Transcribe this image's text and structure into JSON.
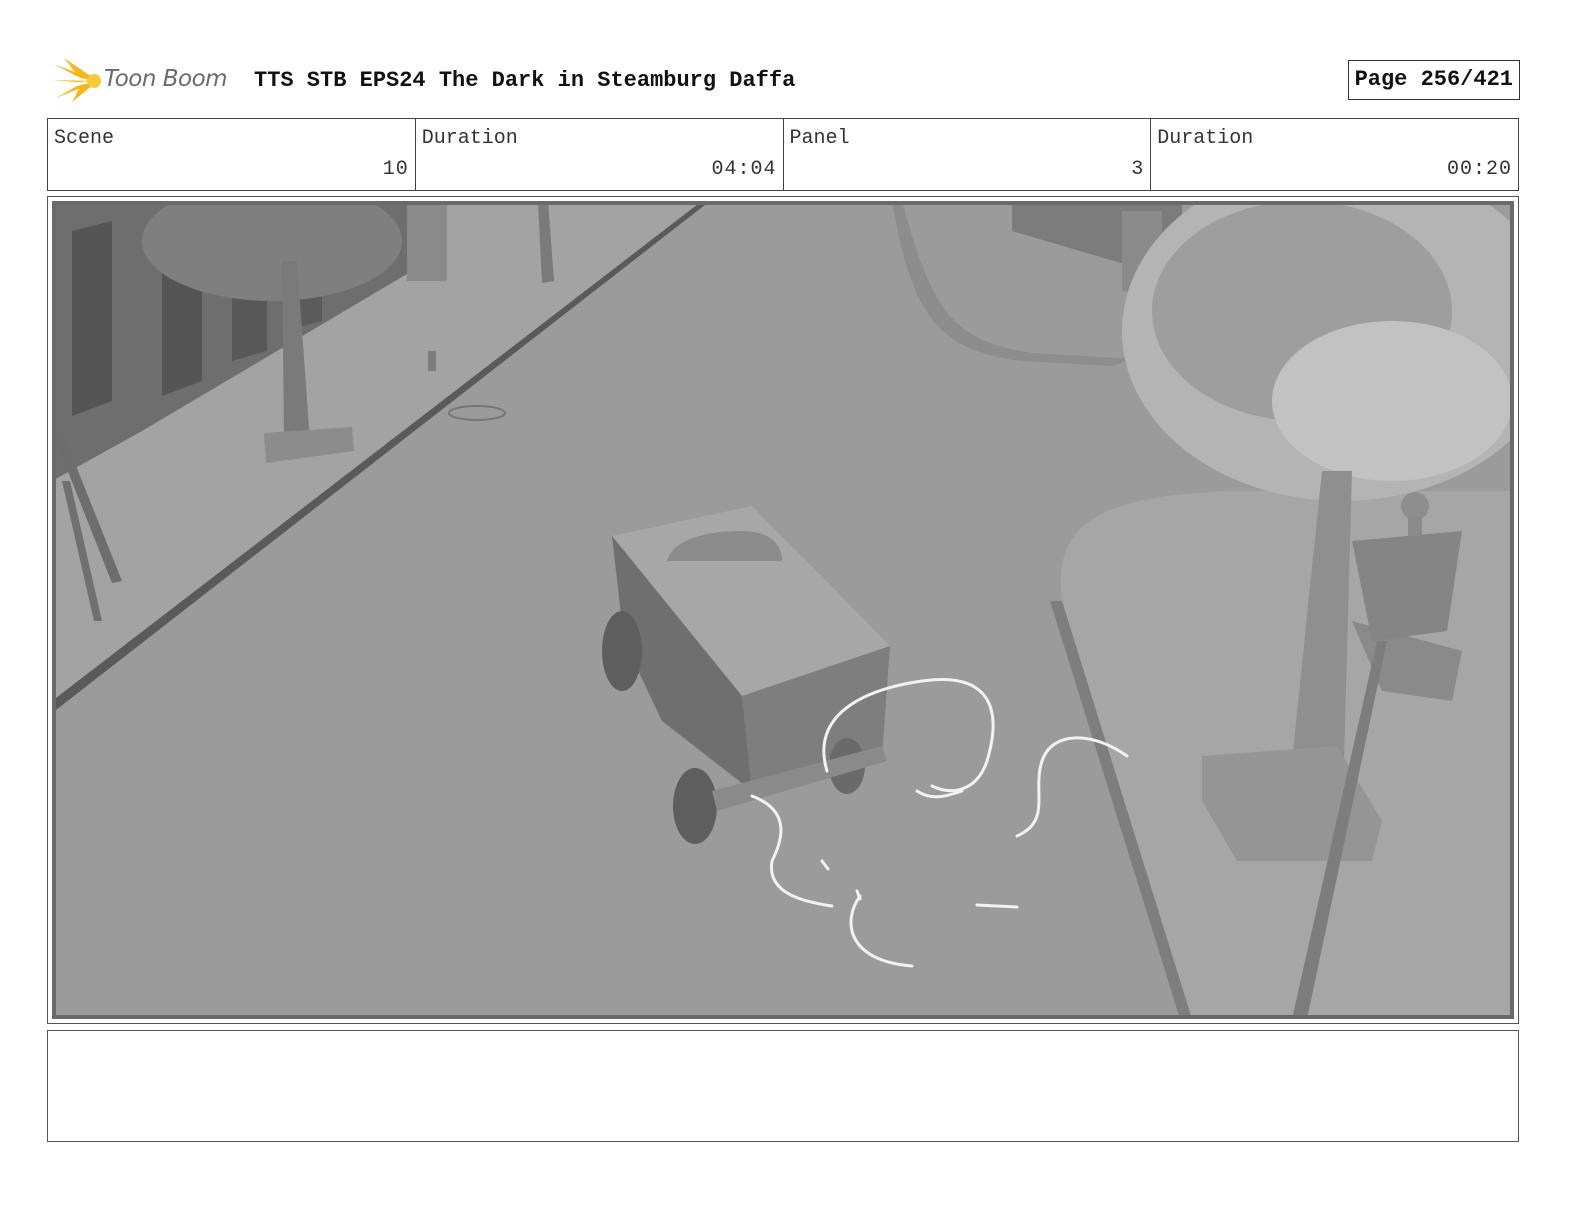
{
  "header": {
    "logo_text": "Toon Boom",
    "title": "TTS STB EPS24 The Dark in Steamburg Daffa",
    "page": "Page 256/421"
  },
  "info": {
    "scene_label": "Scene",
    "scene_value": "10",
    "scene_duration_label": "Duration",
    "scene_duration_value": "04:04",
    "panel_label": "Panel",
    "panel_value": "3",
    "panel_duration_label": "Duration",
    "panel_duration_value": "00:20"
  },
  "notes": {
    "text": ""
  },
  "colors": {
    "logo_flare": "#f5b81c",
    "logo_text": "#6b6b6b",
    "road": "#9a9a9a",
    "sketch": "#f2f2f2"
  }
}
